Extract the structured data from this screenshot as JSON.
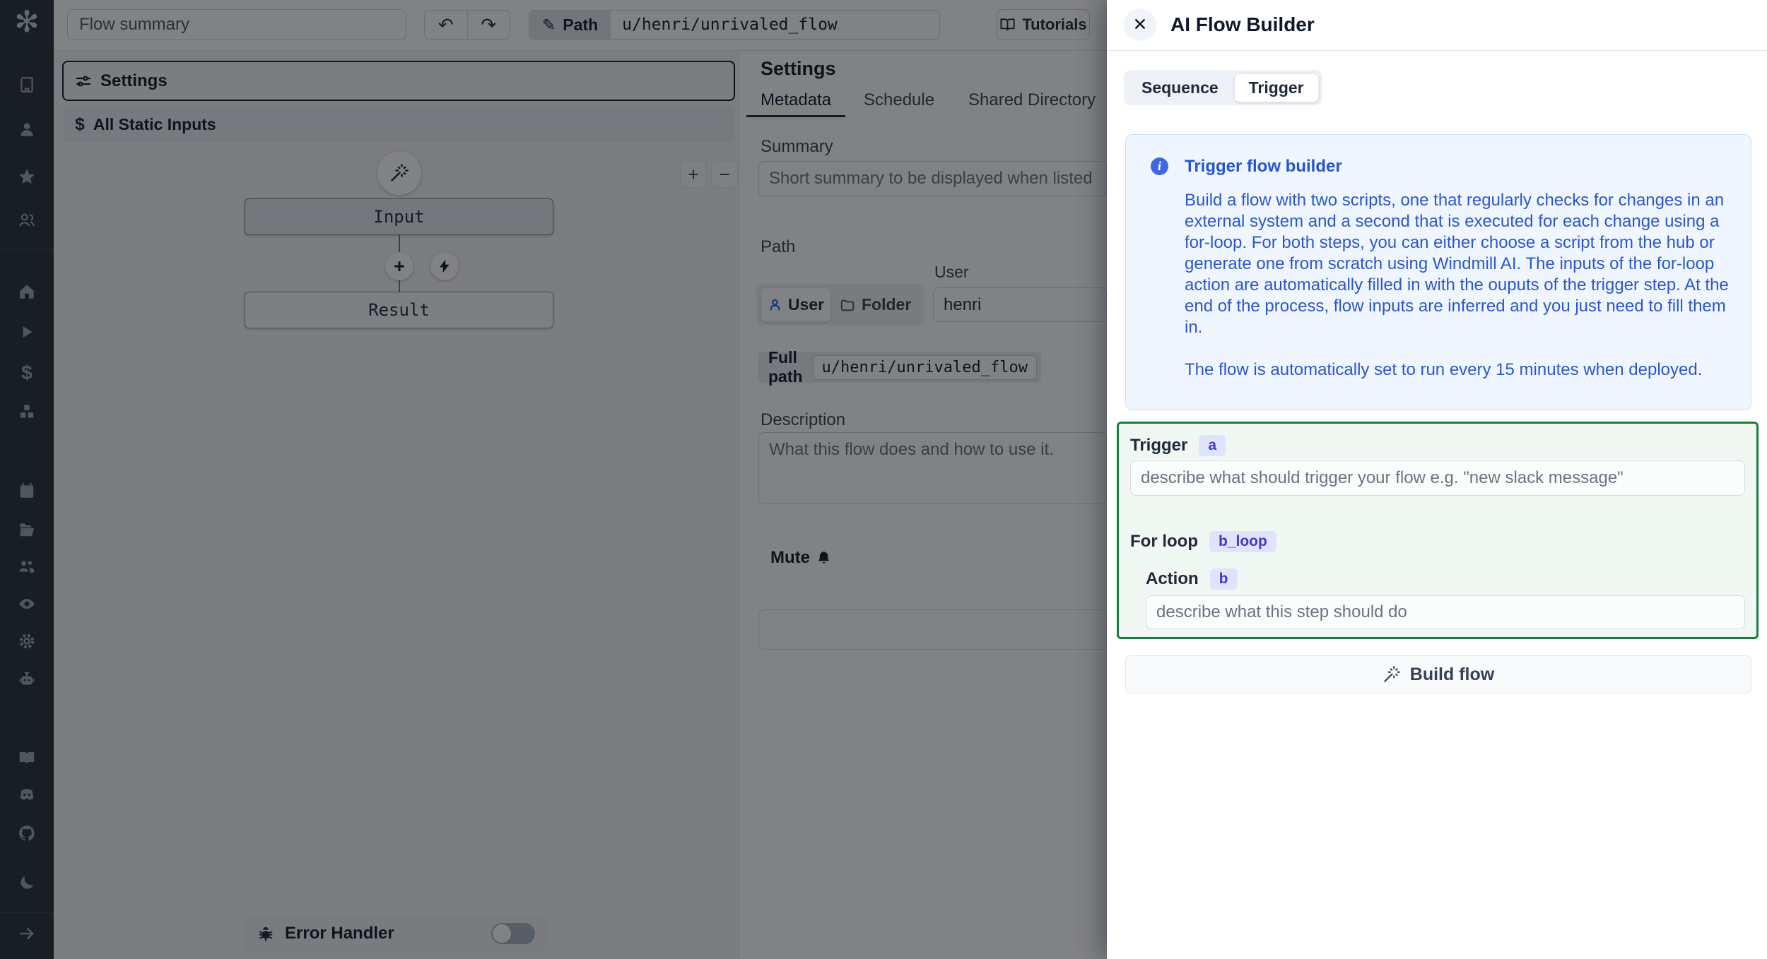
{
  "topbar": {
    "flow_summary_placeholder": "Flow summary",
    "path_chip_label": "Path",
    "path_value": "u/henri/unrivaled_flow",
    "tutorials_label": "Tutorials"
  },
  "toolbar": {
    "settings_label": "Settings",
    "all_static_inputs_label": "All Static Inputs"
  },
  "graph": {
    "input_node_label": "Input",
    "result_node_label": "Result"
  },
  "footer": {
    "error_handler_label": "Error Handler"
  },
  "settings_panel": {
    "title": "Settings",
    "tabs": [
      {
        "label": "Metadata"
      },
      {
        "label": "Schedule"
      },
      {
        "label": "Shared Directory"
      }
    ],
    "summary_label": "Summary",
    "summary_placeholder": "Short summary to be displayed when listed",
    "path_label": "Path",
    "user_field_label": "User",
    "user_toggle_label": "User",
    "folder_toggle_label": "Folder",
    "owner_value": "henri",
    "full_path_label": "Full path",
    "full_path_value": "u/henri/unrivaled_flow",
    "description_label": "Description",
    "description_placeholder": "What this flow does and how to use it.",
    "mute_label": "Mute"
  },
  "ai_panel": {
    "title": "AI Flow Builder",
    "tabs": [
      "Sequence",
      "Trigger"
    ],
    "info": {
      "title": "Trigger flow builder",
      "body1": "Build a flow with two scripts, one that regularly checks for changes in an external system and a second that is executed for each change using a for-loop. For both steps, you can either choose a script from the hub or generate one from scratch using Windmill AI. The inputs of the for-loop action are automatically filled in with the ouputs of the trigger step. At the end of the process, flow inputs are inferred and you just need to fill them in.",
      "body2": "The flow is automatically set to run every 15 minutes when deployed."
    },
    "trigger_label": "Trigger",
    "trigger_badge": "a",
    "trigger_placeholder": "describe what should trigger your flow e.g. \"new slack message\"",
    "forloop_label": "For loop",
    "forloop_badge": "b_loop",
    "action_label": "Action",
    "action_badge": "b",
    "action_placeholder": "describe what this step should do",
    "build_button_label": "Build flow"
  },
  "glyphs": {
    "logo": "✻",
    "close": "✕",
    "undo": "↶",
    "redo": "↷",
    "pencil": "✎",
    "zoom_in": "+",
    "zoom_out": "−",
    "plus": "+",
    "dollar": "$",
    "info": "i"
  },
  "sidebar": {
    "icons": [
      "workspace",
      "user",
      "favorites",
      "groups",
      "home",
      "runs",
      "variables",
      "resources",
      "schedules",
      "folders",
      "workers",
      "audit-logs",
      "settings",
      "ai",
      "docs",
      "discord",
      "github",
      "dark-mode",
      "collapse"
    ]
  },
  "colors": {
    "info_blue_bg": "#eff6ff",
    "info_blue_text": "#2d56cd",
    "trigger_border_green": "#15803d",
    "trigger_bg": "#f1f8f3",
    "badge_bg": "#dee4fc",
    "badge_text": "#4338ca",
    "sidebar_bg": "#262c38",
    "accent_blue": "#2563eb"
  }
}
